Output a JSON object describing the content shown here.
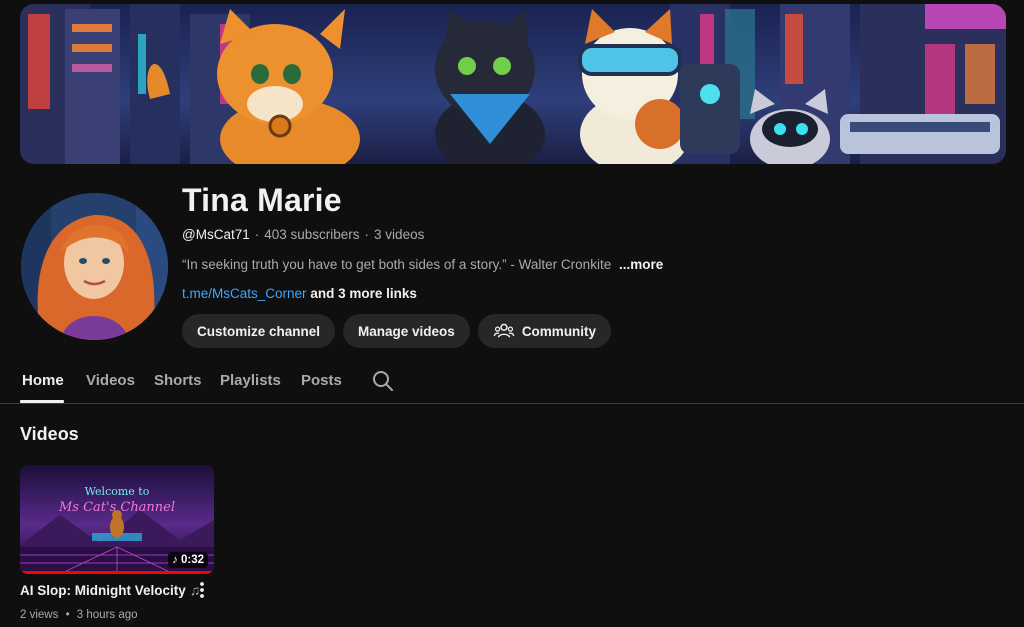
{
  "channel": {
    "name": "Tina Marie",
    "handle": "@MsCat71",
    "subscribers": "403 subscribers",
    "videos_count": "3 videos",
    "description": "“In seeking truth you have to get both sides of a story.” - Walter Cronkite",
    "description_more": "...more",
    "link": "t.me/MsCats_Corner",
    "more_links": "and 3 more links"
  },
  "actions": {
    "customize": "Customize channel",
    "manage": "Manage videos",
    "community": "Community"
  },
  "tabs": [
    {
      "label": "Home",
      "active": true
    },
    {
      "label": "Videos",
      "active": false
    },
    {
      "label": "Shorts",
      "active": false
    },
    {
      "label": "Playlists",
      "active": false
    },
    {
      "label": "Posts",
      "active": false
    }
  ],
  "section": {
    "title": "Videos"
  },
  "videos": [
    {
      "title": "AI Slop: Midnight Velocity",
      "title_glyph": "♫",
      "duration": "0:32",
      "duration_icon": "music-note-icon",
      "views": "2 views",
      "age": "3 hours ago",
      "thumbnail_text_1": "Welcome to",
      "thumbnail_text_2": "Ms Cat's Channel",
      "watch_progress": 1.0
    }
  ],
  "colors": {
    "background": "#0f0f0f",
    "pill": "#272727",
    "link": "#3ea6ff",
    "secondary_text": "#aaaaaa",
    "progress": "#ff0000"
  }
}
